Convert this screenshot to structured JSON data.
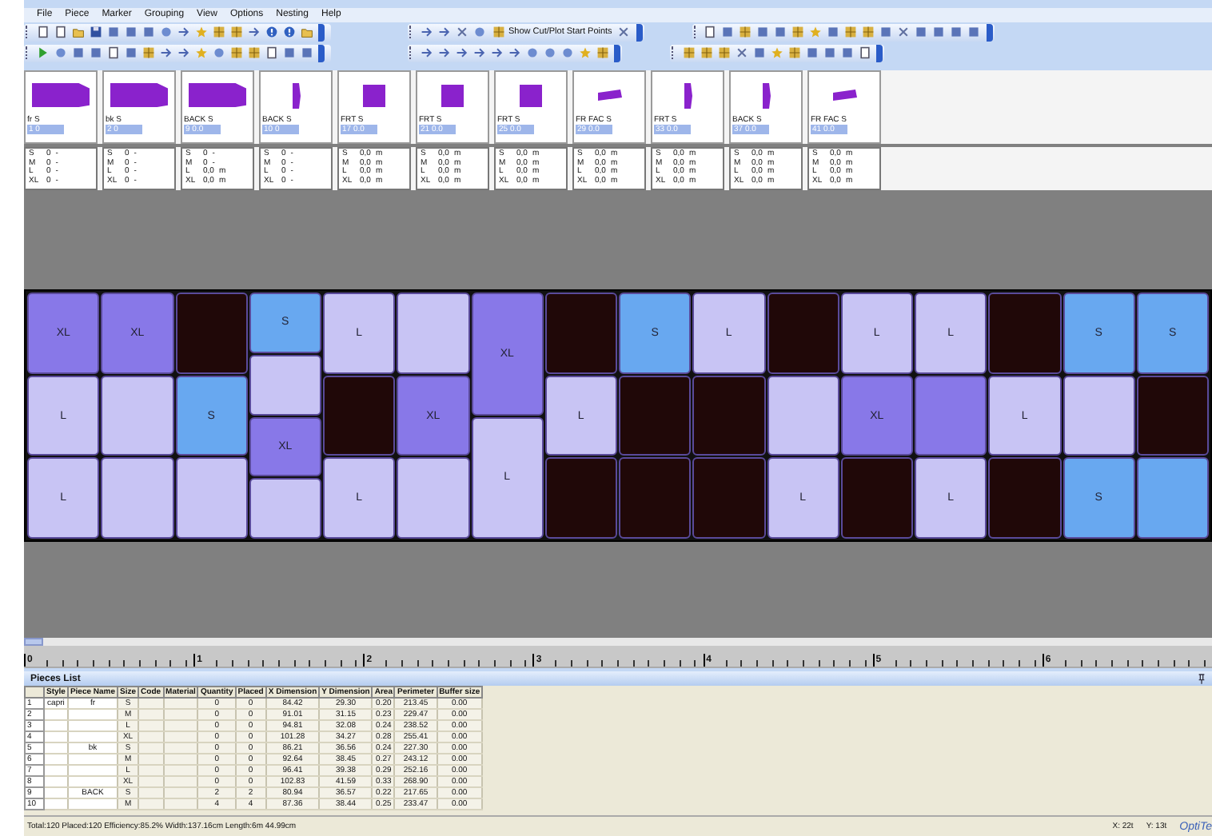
{
  "menu": [
    "File",
    "Piece",
    "Marker",
    "Grouping",
    "View",
    "Options",
    "Nesting",
    "Help"
  ],
  "toolbar_button": "Show Cut/Plot Start Points",
  "pieces_strip": [
    {
      "label": "fr S",
      "value": "1 0",
      "kind": "wide"
    },
    {
      "label": "bk S",
      "value": "2 0",
      "kind": "wide"
    },
    {
      "label": "BACK S",
      "value": "9 0.0",
      "kind": "wide"
    },
    {
      "label": "BACK S",
      "value": "10 0",
      "kind": "narrow"
    },
    {
      "label": "FRT S",
      "value": "17 0.0",
      "kind": "square"
    },
    {
      "label": "FRT S",
      "value": "21 0.0",
      "kind": "square"
    },
    {
      "label": "FRT S",
      "value": "25 0.0",
      "kind": "square"
    },
    {
      "label": "FR FAC S",
      "value": "29 0.0",
      "kind": "small"
    },
    {
      "label": "FRT S",
      "value": "33 0.0",
      "kind": "narrow"
    },
    {
      "label": "BACK S",
      "value": "37 0.0",
      "kind": "narrow"
    },
    {
      "label": "FR FAC S",
      "value": "41 0.0",
      "kind": "small"
    }
  ],
  "size_tables": [
    [
      {
        "size": "S",
        "qty": "0",
        "unit": "-"
      },
      {
        "size": "M",
        "qty": "0",
        "unit": "-"
      },
      {
        "size": "L",
        "qty": "0",
        "unit": "-"
      },
      {
        "size": "XL",
        "qty": "0",
        "unit": "-"
      }
    ],
    [
      {
        "size": "S",
        "qty": "0",
        "unit": "-"
      },
      {
        "size": "M",
        "qty": "0",
        "unit": "-"
      },
      {
        "size": "L",
        "qty": "0",
        "unit": "-"
      },
      {
        "size": "XL",
        "qty": "0",
        "unit": "-"
      }
    ],
    [
      {
        "size": "S",
        "qty": "0",
        "unit": "-"
      },
      {
        "size": "M",
        "qty": "0",
        "unit": "-"
      },
      {
        "size": "L",
        "qty": "0,0",
        "unit": "m"
      },
      {
        "size": "XL",
        "qty": "0,0",
        "unit": "m"
      }
    ],
    [
      {
        "size": "S",
        "qty": "0",
        "unit": "-"
      },
      {
        "size": "M",
        "qty": "0",
        "unit": "-"
      },
      {
        "size": "L",
        "qty": "0",
        "unit": "-"
      },
      {
        "size": "XL",
        "qty": "0",
        "unit": "-"
      }
    ],
    [
      {
        "size": "S",
        "qty": "0,0",
        "unit": "m"
      },
      {
        "size": "M",
        "qty": "0,0",
        "unit": "m"
      },
      {
        "size": "L",
        "qty": "0,0",
        "unit": "m"
      },
      {
        "size": "XL",
        "qty": "0,0",
        "unit": "m"
      }
    ],
    [
      {
        "size": "S",
        "qty": "0,0",
        "unit": "m"
      },
      {
        "size": "M",
        "qty": "0,0",
        "unit": "m"
      },
      {
        "size": "L",
        "qty": "0,0",
        "unit": "m"
      },
      {
        "size": "XL",
        "qty": "0,0",
        "unit": "m"
      }
    ],
    [
      {
        "size": "S",
        "qty": "0,0",
        "unit": "m"
      },
      {
        "size": "M",
        "qty": "0,0",
        "unit": "m"
      },
      {
        "size": "L",
        "qty": "0,0",
        "unit": "m"
      },
      {
        "size": "XL",
        "qty": "0,0",
        "unit": "m"
      }
    ],
    [
      {
        "size": "S",
        "qty": "0,0",
        "unit": "m"
      },
      {
        "size": "M",
        "qty": "0,0",
        "unit": "m"
      },
      {
        "size": "L",
        "qty": "0,0",
        "unit": "m"
      },
      {
        "size": "XL",
        "qty": "0,0",
        "unit": "m"
      }
    ],
    [
      {
        "size": "S",
        "qty": "0,0",
        "unit": "m"
      },
      {
        "size": "M",
        "qty": "0,0",
        "unit": "m"
      },
      {
        "size": "L",
        "qty": "0,0",
        "unit": "m"
      },
      {
        "size": "XL",
        "qty": "0,0",
        "unit": "m"
      }
    ],
    [
      {
        "size": "S",
        "qty": "0,0",
        "unit": "m"
      },
      {
        "size": "M",
        "qty": "0,0",
        "unit": "m"
      },
      {
        "size": "L",
        "qty": "0,0",
        "unit": "m"
      },
      {
        "size": "XL",
        "qty": "0,0",
        "unit": "m"
      }
    ],
    [
      {
        "size": "S",
        "qty": "0,0",
        "unit": "m"
      },
      {
        "size": "M",
        "qty": "0,0",
        "unit": "m"
      },
      {
        "size": "L",
        "qty": "0,0",
        "unit": "m"
      },
      {
        "size": "XL",
        "qty": "0,0",
        "unit": "m"
      }
    ]
  ],
  "marker": {
    "columns": [
      [
        {
          "size": "XL",
          "color": "#8878e8"
        },
        {
          "size": "L",
          "color": "#c8c4f4"
        },
        {
          "size": "L",
          "color": "#c8c4f4"
        }
      ],
      [
        {
          "size": "XL",
          "color": "#8878e8"
        },
        {
          "color": "#c8c4f4"
        },
        {
          "color": "#c8c4f4"
        }
      ],
      [
        {
          "color": "#200808"
        },
        {
          "size": "S",
          "color": "#68a8f0"
        },
        {
          "color": "#c8c4f4"
        }
      ],
      [
        {
          "size": "S",
          "color": "#68a8f0"
        },
        {
          "color": "#c8c4f4"
        },
        {
          "size": "XL",
          "color": "#8878e8"
        },
        {
          "color": "#c8c4f4"
        }
      ],
      [
        {
          "size": "L",
          "color": "#c8c4f4"
        },
        {
          "color": "#200808"
        },
        {
          "size": "L",
          "color": "#c8c4f4"
        }
      ],
      [
        {
          "color": "#c8c4f4"
        },
        {
          "size": "XL",
          "color": "#8878e8"
        },
        {
          "color": "#c8c4f4"
        }
      ],
      [
        {
          "size": "XL",
          "color": "#8878e8"
        },
        {
          "size": "L",
          "color": "#c8c4f4"
        }
      ],
      [
        {
          "color": "#200808"
        },
        {
          "size": "L",
          "color": "#c8c4f4"
        },
        {
          "color": "#200808"
        }
      ],
      [
        {
          "size": "S",
          "color": "#68a8f0"
        },
        {
          "color": "#200808"
        },
        {
          "color": "#200808"
        }
      ],
      [
        {
          "size": "L",
          "color": "#c8c4f4"
        },
        {
          "color": "#200808"
        },
        {
          "color": "#200808"
        }
      ],
      [
        {
          "color": "#200808"
        },
        {
          "color": "#c8c4f4"
        },
        {
          "size": "L",
          "color": "#c8c4f4"
        }
      ],
      [
        {
          "size": "L",
          "color": "#c8c4f4"
        },
        {
          "size": "XL",
          "color": "#8878e8"
        },
        {
          "color": "#200808"
        }
      ],
      [
        {
          "size": "L",
          "color": "#c8c4f4"
        },
        {
          "color": "#8878e8"
        },
        {
          "size": "L",
          "color": "#c8c4f4"
        }
      ],
      [
        {
          "color": "#200808"
        },
        {
          "size": "L",
          "color": "#c8c4f4"
        },
        {
          "color": "#200808"
        }
      ],
      [
        {
          "size": "S",
          "color": "#68a8f0"
        },
        {
          "color": "#c8c4f4"
        },
        {
          "size": "S",
          "color": "#68a8f0"
        }
      ],
      [
        {
          "size": "S",
          "color": "#68a8f0"
        },
        {
          "color": "#200808"
        },
        {
          "color": "#68a8f0"
        }
      ]
    ]
  },
  "ruler": {
    "labels": [
      "0",
      "1",
      "2",
      "3",
      "4",
      "5",
      "6"
    ]
  },
  "pieces_list": {
    "title": "Pieces List",
    "columns": [
      "Style",
      "Piece Name",
      "Size",
      "Code",
      "Material",
      "Quantity",
      "Placed",
      "X Dimension",
      "Y Dimension",
      "Area",
      "Perimeter",
      "Buffer size"
    ],
    "rows": [
      {
        "num": "1",
        "style": "capri",
        "piece_name": "fr",
        "size": "S",
        "quantity": "0",
        "placed": "0",
        "x_dimension": "84.42",
        "y_dimension": "29.30",
        "area": "0.20",
        "perimeter": "213.45",
        "buffer_size": "0.00"
      },
      {
        "num": "2",
        "size": "M",
        "quantity": "0",
        "placed": "0",
        "x_dimension": "91.01",
        "y_dimension": "31.15",
        "area": "0.23",
        "perimeter": "229.47",
        "buffer_size": "0.00"
      },
      {
        "num": "3",
        "size": "L",
        "quantity": "0",
        "placed": "0",
        "x_dimension": "94.81",
        "y_dimension": "32.08",
        "area": "0.24",
        "perimeter": "238.52",
        "buffer_size": "0.00"
      },
      {
        "num": "4",
        "size": "XL",
        "quantity": "0",
        "placed": "0",
        "x_dimension": "101.28",
        "y_dimension": "34.27",
        "area": "0.28",
        "perimeter": "255.41",
        "buffer_size": "0.00"
      },
      {
        "num": "5",
        "piece_name": "bk",
        "size": "S",
        "quantity": "0",
        "placed": "0",
        "x_dimension": "86.21",
        "y_dimension": "36.56",
        "area": "0.24",
        "perimeter": "227.30",
        "buffer_size": "0.00"
      },
      {
        "num": "6",
        "size": "M",
        "quantity": "0",
        "placed": "0",
        "x_dimension": "92.64",
        "y_dimension": "38.45",
        "area": "0.27",
        "perimeter": "243.12",
        "buffer_size": "0.00"
      },
      {
        "num": "7",
        "size": "L",
        "quantity": "0",
        "placed": "0",
        "x_dimension": "96.41",
        "y_dimension": "39.38",
        "area": "0.29",
        "perimeter": "252.16",
        "buffer_size": "0.00"
      },
      {
        "num": "8",
        "size": "XL",
        "quantity": "0",
        "placed": "0",
        "x_dimension": "102.83",
        "y_dimension": "41.59",
        "area": "0.33",
        "perimeter": "268.90",
        "buffer_size": "0.00"
      },
      {
        "num": "9",
        "piece_name": "BACK",
        "size": "S",
        "quantity": "2",
        "placed": "2",
        "x_dimension": "80.94",
        "y_dimension": "36.57",
        "area": "0.22",
        "perimeter": "217.65",
        "buffer_size": "0.00"
      },
      {
        "num": "10",
        "size": "M",
        "quantity": "4",
        "placed": "4",
        "x_dimension": "87.36",
        "y_dimension": "38.44",
        "area": "0.25",
        "perimeter": "233.47",
        "buffer_size": "0.00"
      }
    ]
  },
  "status_bar": {
    "summary": "Total:120 Placed:120 Efficiency:85.2% Width:137.16cm Length:6m 44.99cm",
    "x": "X: 22t",
    "y": "Y: 13t",
    "logo": "OptiTe"
  }
}
